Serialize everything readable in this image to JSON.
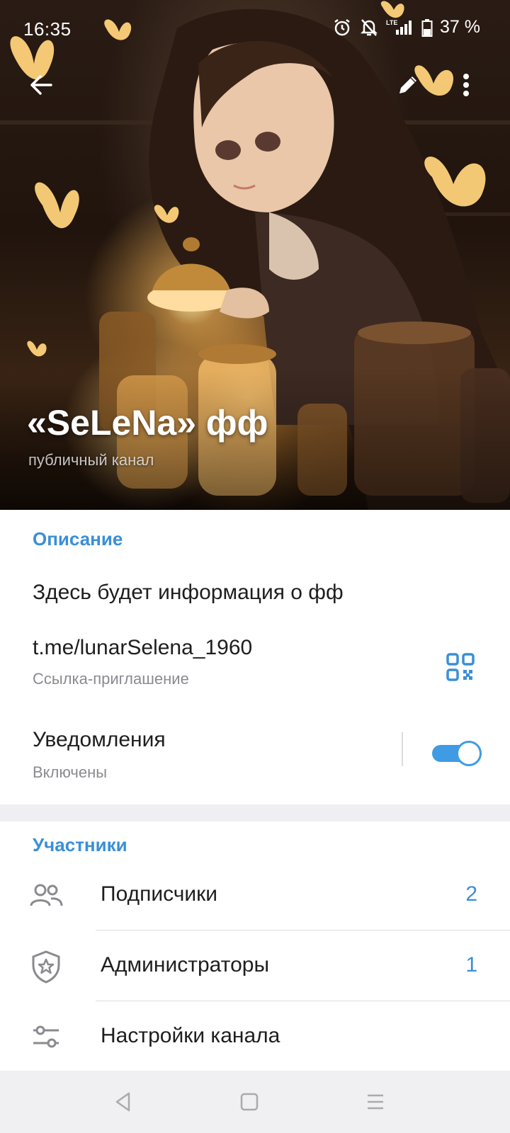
{
  "status_bar": {
    "time": "16:35",
    "network": "LTE",
    "battery": "37 %",
    "icons": [
      "alarm-icon",
      "mute-notifications-icon",
      "signal-icon",
      "battery-icon"
    ]
  },
  "header": {
    "title": "«SeLeNa» фф",
    "subtitle": "публичный канал",
    "actions": [
      "back-arrow-icon",
      "edit-pencil-icon",
      "more-vertical-icon"
    ]
  },
  "info": {
    "section_title": "Описание",
    "description": "Здесь будет информация о фф",
    "link": "t.me/lunarSelena_1960",
    "link_caption": "Ссылка-приглашение",
    "link_icon": "qr-code-icon",
    "notifications_label": "Уведомления",
    "notifications_status": "Включены",
    "notifications_enabled": true
  },
  "members": {
    "section_title": "Участники",
    "rows": [
      {
        "label": "Подписчики",
        "count": "2",
        "icon": "people-icon"
      },
      {
        "label": "Администраторы",
        "count": "1",
        "icon": "shield-star-icon"
      },
      {
        "label": "Настройки канала",
        "count": "",
        "icon": "sliders-icon"
      }
    ]
  },
  "nav": {
    "buttons": [
      "back-triangle-icon",
      "home-square-icon",
      "menu-lines-icon"
    ]
  },
  "colors": {
    "accent": "#3a8fd6",
    "toggle": "#3f9be3",
    "background": "#efeff3"
  }
}
